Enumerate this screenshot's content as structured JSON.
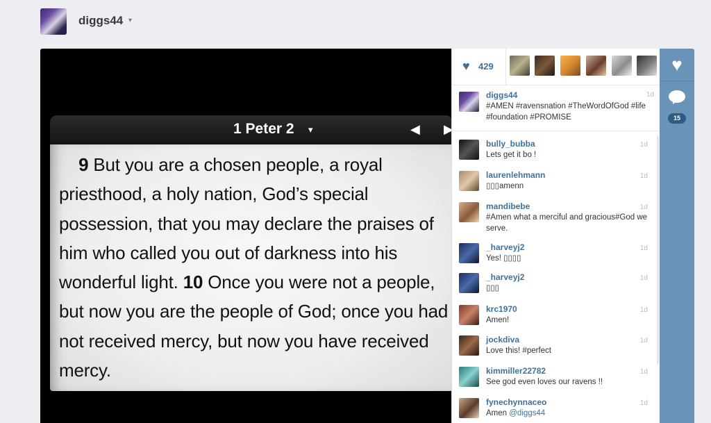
{
  "header": {
    "username": "diggs44",
    "caret": "▾"
  },
  "photo": {
    "bible_title": "1 Peter 2",
    "title_caret": "▾",
    "prev_icon": "◀",
    "next_icon": "▶",
    "verse9_num": "9",
    "verse9_text": " But you are a chosen people, a royal priesthood, a holy nation, God’s special possession, that you may declare the praises of him who called you out of darkness into his wonderful light. ",
    "verse10_num": "10",
    "verse10_text": " Once you were not a people, but now you are the people of God; once you had not received mercy, but now you have received mercy."
  },
  "likes": {
    "count": "429",
    "heart_icon": "♥"
  },
  "caption": {
    "user": "diggs44",
    "time": "1d",
    "text": "#AMEN #ravensnation #TheWordOfGod #life #foundation #PROMISE"
  },
  "comments": [
    {
      "user": "bully_bubba",
      "text": "Lets get it bo !",
      "time": "1d"
    },
    {
      "user": "laurenlehmann",
      "text": "▯▯▯amenn",
      "time": "1d"
    },
    {
      "user": "mandibebe",
      "text": "#Amen what a merciful and gracious#God we serve.",
      "time": "1d"
    },
    {
      "user": "_harveyj2",
      "text": "Yes! ▯▯▯▯",
      "time": "1d"
    },
    {
      "user": "_harveyj2",
      "text": "▯▯▯",
      "time": "1d"
    },
    {
      "user": "krc1970",
      "text": "Amen!",
      "time": "1d"
    },
    {
      "user": "jockdiva",
      "text": "Love this! #perfect",
      "time": "1d"
    },
    {
      "user": "kimmiller22782",
      "text": "See god even loves our ravens !!",
      "time": "1d"
    },
    {
      "user": "fynechynnaceo",
      "text": "Amen ",
      "mention": "@diggs44",
      "time": "1d"
    }
  ],
  "actions": {
    "like_icon": "♥",
    "comment_count": "15"
  },
  "colors": {
    "accent": "#3f729b",
    "action_bar": "#6a93b8",
    "badge": "#2d5b85"
  }
}
